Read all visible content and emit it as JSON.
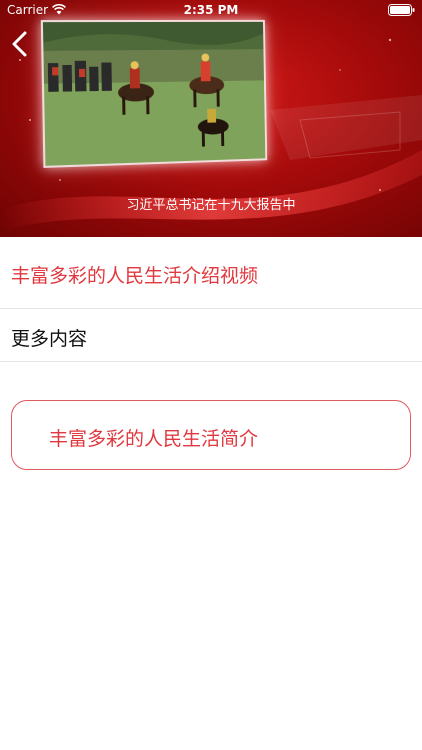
{
  "status_bar": {
    "carrier": "Carrier",
    "time": "2:35 PM",
    "wifi_icon": "wifi-icon",
    "battery_icon": "battery-icon"
  },
  "header": {
    "back_icon": "chevron-left-icon",
    "caption": "习近平总书记在十九大报告中",
    "background_color": "#b81212"
  },
  "section": {
    "title": "丰富多彩的人民生活介绍视频",
    "title_color": "#e0383e"
  },
  "more": {
    "label": "更多内容"
  },
  "intro_button": {
    "label": "丰富多彩的人民生活简介",
    "color": "#e0383e"
  }
}
